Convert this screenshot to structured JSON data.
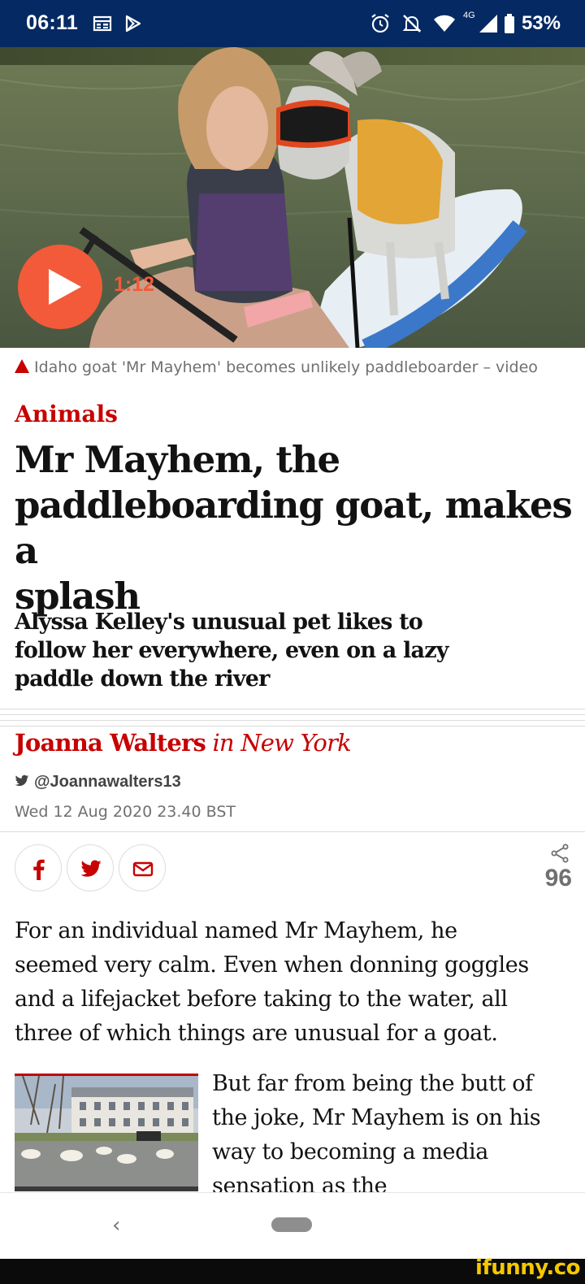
{
  "status_bar": {
    "time": "06:11",
    "battery_percent": "53%",
    "network": "4G",
    "icons": [
      "calendar-icon",
      "play-store-icon",
      "alarm-icon",
      "mute-icon",
      "wifi-icon",
      "signal-icon",
      "battery-icon"
    ]
  },
  "video": {
    "duration": "1:12",
    "play_icon": "play-icon"
  },
  "caption": "Idaho goat 'Mr Mayhem' becomes unlikely paddleboarder – video",
  "article": {
    "section": "Animals",
    "headline_lines": [
      "Mr Mayhem, the",
      "paddleboarding goat, makes a",
      "splash"
    ],
    "standfirst_lines": [
      "Alyssa Kelley's unusual pet likes to",
      "follow her everywhere, even on a lazy",
      "paddle down the river"
    ],
    "author": "Joanna Walters",
    "location": "in New York",
    "twitter": "@Joannawalters13",
    "date": "Wed 12 Aug 2020 23.40 BST",
    "share_count": "96",
    "paragraph1_lines": [
      "For an individual named Mr Mayhem, he",
      "seemed very calm. Even when donning goggles",
      "and a lifejacket before taking to the water, all",
      "three of which things are unusual for a goat."
    ],
    "paragraph2_lines": [
      "But far from being the butt of",
      "the joke, Mr Mayhem is on his",
      "way to becoming a media",
      "sensation as the"
    ]
  },
  "nav": {
    "back": "‹"
  },
  "watermark": "ifunny.co",
  "colors": {
    "guardian_red": "#c70000",
    "guardian_blue": "#052962",
    "play_orange": "#f25a3a"
  }
}
